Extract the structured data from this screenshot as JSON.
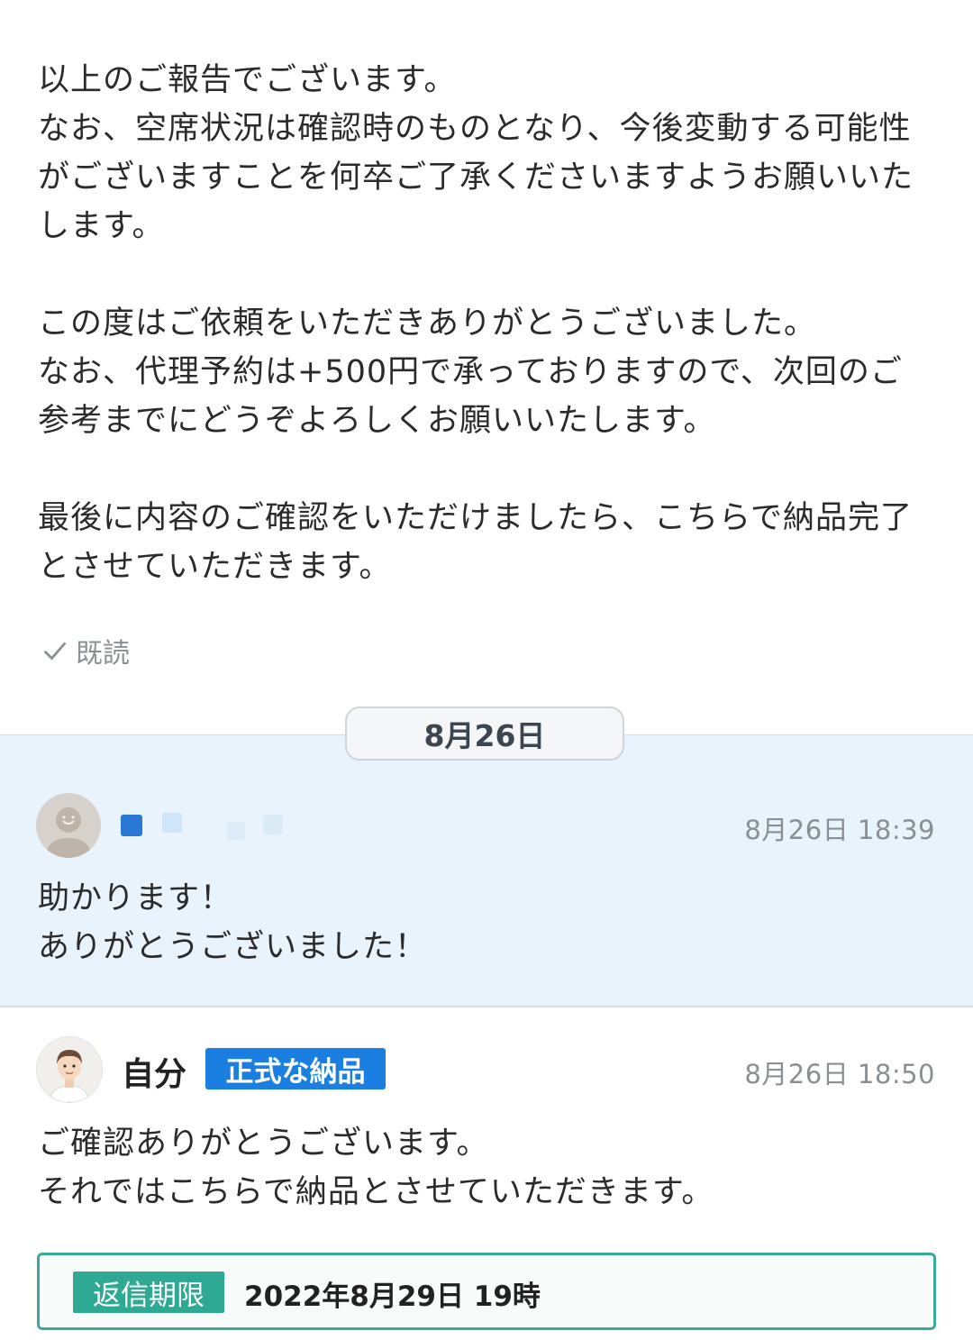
{
  "top_message": {
    "lines": [
      "以上のご報告でございます。",
      "なお、空席状況は確認時のものとなり、今後変動する可能性",
      "がございますことを何卒ご了承くださいますようお願いいた",
      "します。",
      "",
      "この度はご依頼をいただきありがとうございました。",
      "なお、代理予約は+500円で承っておりますので、次回のご",
      "参考までにどうぞよろしくお願いいたします。",
      "",
      "最後に内容のご確認をいただけましたら、こちらで納品完了",
      "とさせていただきます。"
    ],
    "read_status": "既読"
  },
  "date_separator": "8月26日",
  "incoming_message": {
    "time": "8月26日 18:39",
    "lines": [
      "助かります！",
      "ありがとうございました！"
    ]
  },
  "self_message": {
    "name": "自分",
    "badge": "正式な納品",
    "time": "8月26日 18:50",
    "lines": [
      "ご確認ありがとうございます。",
      "それではこちらで納品とさせていただきます。"
    ]
  },
  "deadline": {
    "label": "返信期限",
    "value": "2022年8月29日 19時"
  },
  "colors": {
    "incoming_bg": "#e9f3fb",
    "badge_blue": "#1a7fe0",
    "deadline_green": "#2ea993"
  }
}
